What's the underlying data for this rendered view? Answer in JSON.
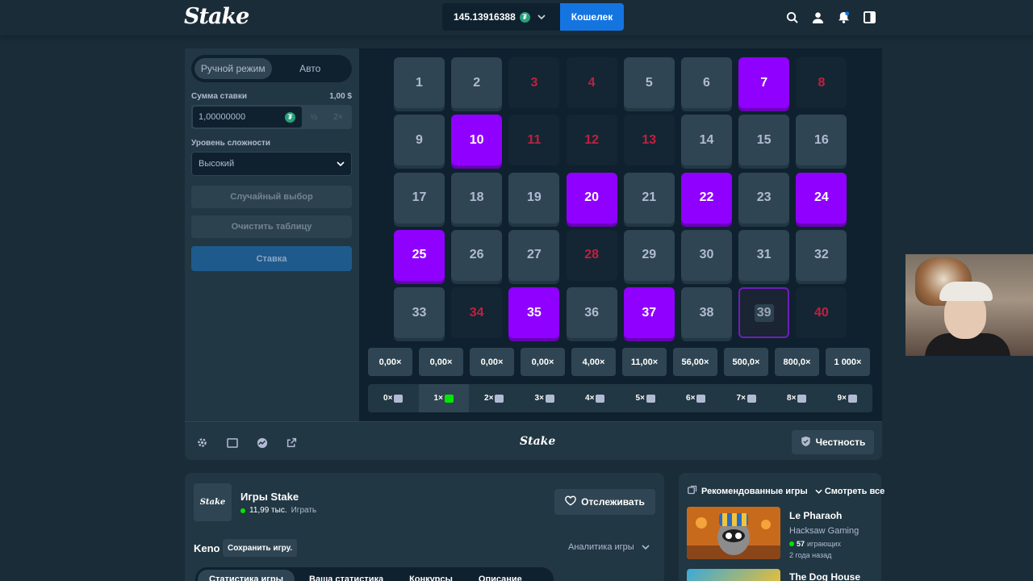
{
  "header": {
    "logo": "Stake",
    "balance": "145.13916388",
    "currency_symbol": "₮",
    "wallet_label": "Кошелек"
  },
  "sidebar": {
    "mode_manual": "Ручной режим",
    "mode_auto": "Авто",
    "bet_amount_label": "Сумма ставки",
    "bet_amount_usd": "1,00 $",
    "bet_amount_value": "1,00000000",
    "half_label": "½",
    "double_label": "2×",
    "difficulty_label": "Уровень сложности",
    "difficulty_value": "Высокий",
    "random_pick_label": "Случайный выбор",
    "clear_table_label": "Очистить таблицу",
    "bet_label": "Ставка"
  },
  "board": {
    "tiles": [
      {
        "n": "1",
        "s": "idle"
      },
      {
        "n": "2",
        "s": "idle"
      },
      {
        "n": "3",
        "s": "miss"
      },
      {
        "n": "4",
        "s": "miss"
      },
      {
        "n": "5",
        "s": "idle"
      },
      {
        "n": "6",
        "s": "idle"
      },
      {
        "n": "7",
        "s": "hit"
      },
      {
        "n": "8",
        "s": "miss"
      },
      {
        "n": "9",
        "s": "idle"
      },
      {
        "n": "10",
        "s": "hit"
      },
      {
        "n": "11",
        "s": "miss"
      },
      {
        "n": "12",
        "s": "miss"
      },
      {
        "n": "13",
        "s": "miss"
      },
      {
        "n": "14",
        "s": "idle"
      },
      {
        "n": "15",
        "s": "idle"
      },
      {
        "n": "16",
        "s": "idle"
      },
      {
        "n": "17",
        "s": "idle"
      },
      {
        "n": "18",
        "s": "idle"
      },
      {
        "n": "19",
        "s": "idle"
      },
      {
        "n": "20",
        "s": "hit"
      },
      {
        "n": "21",
        "s": "idle"
      },
      {
        "n": "22",
        "s": "hit"
      },
      {
        "n": "23",
        "s": "idle"
      },
      {
        "n": "24",
        "s": "hit"
      },
      {
        "n": "25",
        "s": "hit"
      },
      {
        "n": "26",
        "s": "idle"
      },
      {
        "n": "27",
        "s": "idle"
      },
      {
        "n": "28",
        "s": "miss"
      },
      {
        "n": "29",
        "s": "idle"
      },
      {
        "n": "30",
        "s": "idle"
      },
      {
        "n": "31",
        "s": "idle"
      },
      {
        "n": "32",
        "s": "idle"
      },
      {
        "n": "33",
        "s": "idle"
      },
      {
        "n": "34",
        "s": "miss"
      },
      {
        "n": "35",
        "s": "hit"
      },
      {
        "n": "36",
        "s": "idle"
      },
      {
        "n": "37",
        "s": "hit"
      },
      {
        "n": "38",
        "s": "idle"
      },
      {
        "n": "39",
        "s": "sel"
      },
      {
        "n": "40",
        "s": "miss"
      }
    ],
    "payouts": [
      "0,00×",
      "0,00×",
      "0,00×",
      "0,00×",
      "4,00×",
      "11,00×",
      "56,00×",
      "500,0×",
      "800,0×",
      "1 000×"
    ],
    "hits": [
      {
        "label": "0×",
        "gem": "grey",
        "active": false
      },
      {
        "label": "1×",
        "gem": "green",
        "active": true
      },
      {
        "label": "2×",
        "gem": "grey",
        "active": false
      },
      {
        "label": "3×",
        "gem": "grey",
        "active": false
      },
      {
        "label": "4×",
        "gem": "grey",
        "active": false
      },
      {
        "label": "5×",
        "gem": "grey",
        "active": false
      },
      {
        "label": "6×",
        "gem": "grey",
        "active": false
      },
      {
        "label": "7×",
        "gem": "grey",
        "active": false
      },
      {
        "label": "8×",
        "gem": "grey",
        "active": false
      },
      {
        "label": "9×",
        "gem": "grey",
        "active": false
      }
    ]
  },
  "footerbar": {
    "logo": "Stake",
    "fairness_label": "Честность"
  },
  "info": {
    "provider_logo": "Stake",
    "provider_name": "Игры Stake",
    "players": "11,99 тыс.",
    "play_label": "Играть",
    "follow_label": "Отслеживать",
    "game_name": "Keno",
    "save_label": "Сохранить игру.",
    "analytics_label": "Аналитика игры",
    "tabs": [
      "Статистика игры",
      "Ваша статистика",
      "Конкурсы",
      "Описание"
    ]
  },
  "recs": {
    "title": "Рекомендованные игры",
    "see_all": "Смотреть все",
    "items": [
      {
        "title": "Le Pharaoh",
        "provider": "Hacksaw Gaming",
        "players": "57",
        "players_suffix": "играющих",
        "time": "2 года назад"
      },
      {
        "title": "The Dog House"
      }
    ]
  },
  "colors": {
    "bg": "#1a2c38",
    "panel": "#213743",
    "dark": "#0f212e",
    "tile": "#2f4553",
    "hit": "#9000ff",
    "miss_text": "#c0203f",
    "wallet": "#1475e1",
    "green": "#00e701"
  }
}
